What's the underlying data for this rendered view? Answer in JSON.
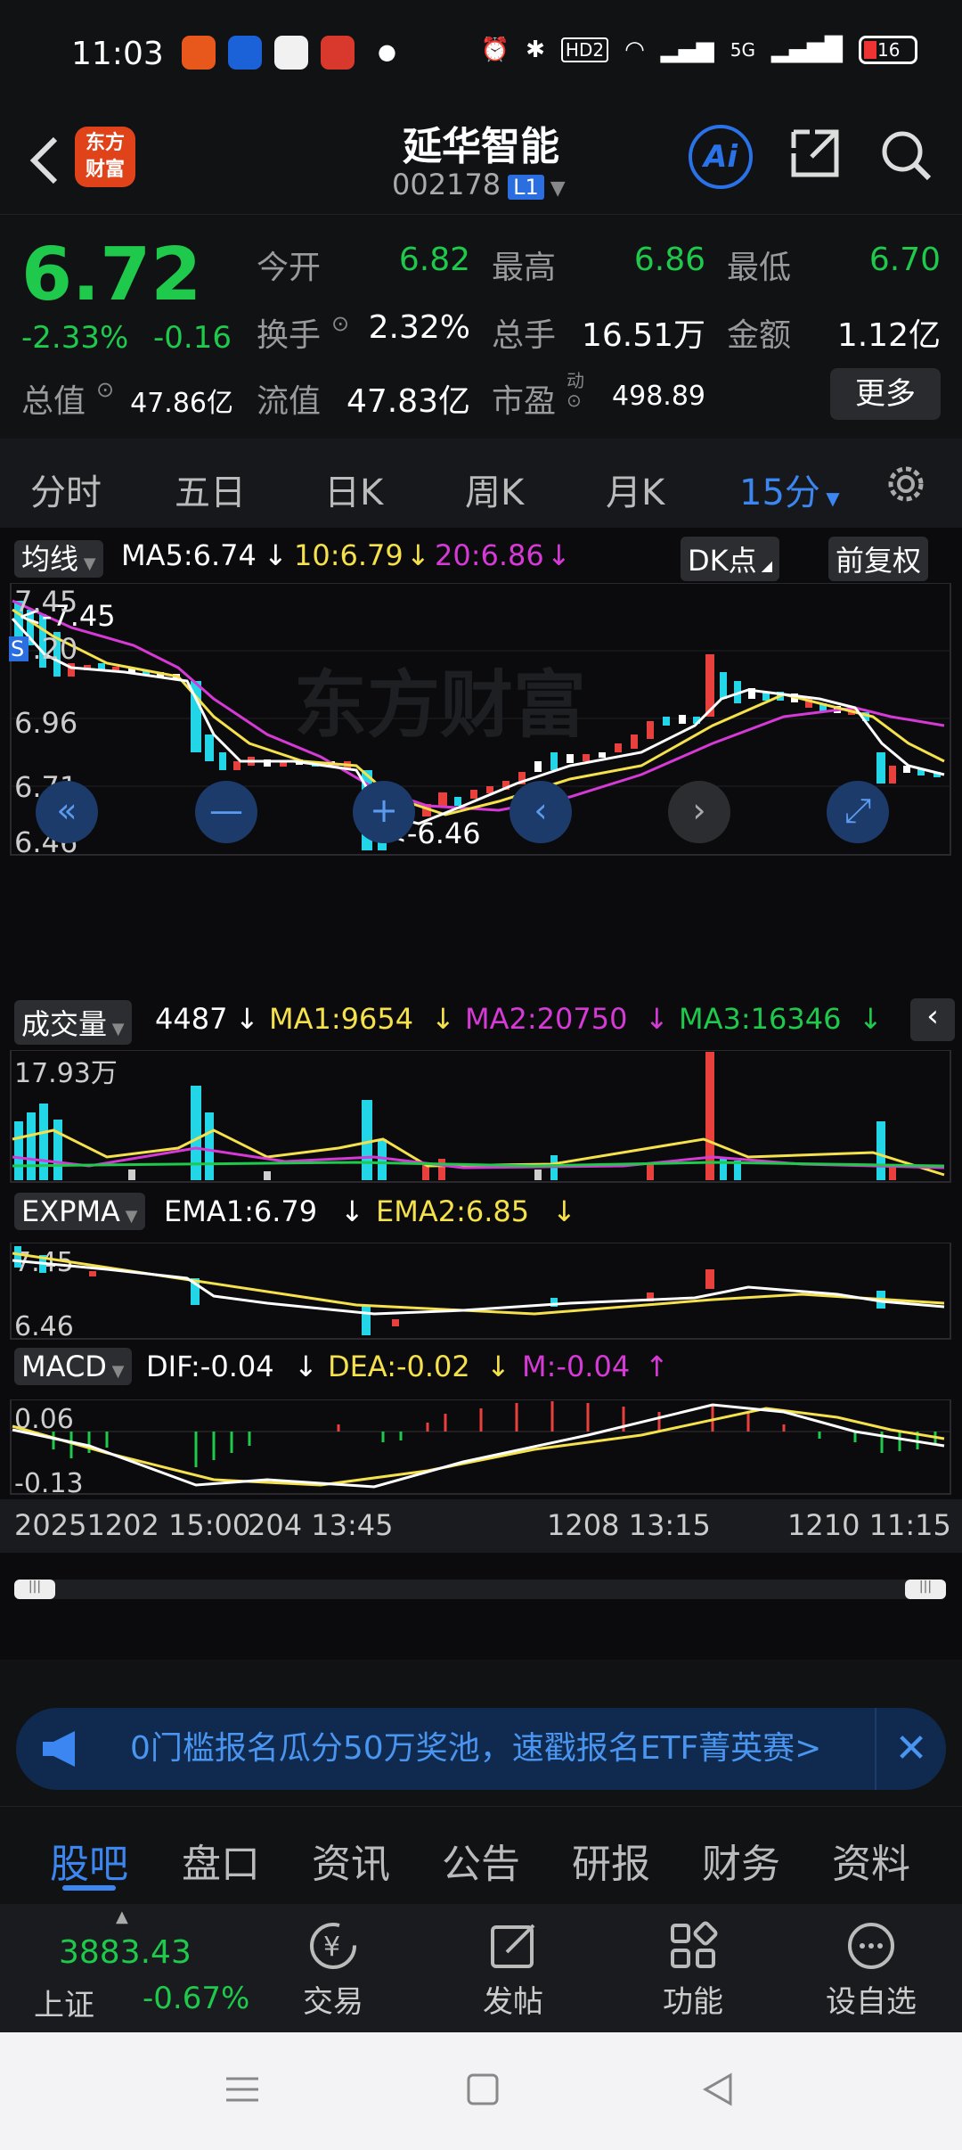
{
  "status_bar": {
    "time": "11:03",
    "battery": "16",
    "network": "5G",
    "hd": "HD2"
  },
  "header": {
    "title": "延华智能",
    "code": "002178",
    "level_badge": "L1",
    "logo_line1": "东方",
    "logo_line2": "财富",
    "ai_label": "Ai"
  },
  "quote": {
    "price": "6.72",
    "change_pct": "-2.33%",
    "change_abs": "-0.16",
    "open_label": "今开",
    "open": "6.82",
    "high_label": "最高",
    "high": "6.86",
    "low_label": "最低",
    "low": "6.70",
    "turnover_label": "换手",
    "turnover": "2.32%",
    "volume_label": "总手",
    "volume": "16.51万",
    "amount_label": "金额",
    "amount": "1.12亿",
    "total_mv_label": "总值",
    "total_mv": "47.86亿",
    "float_mv_label": "流值",
    "float_mv": "47.83亿",
    "pe_label": "市盈",
    "pe_sup": "动",
    "pe": "498.89",
    "more_label": "更多"
  },
  "periods": [
    "分时",
    "五日",
    "日K",
    "周K",
    "月K",
    "15分"
  ],
  "ma_legend": {
    "label": "均线",
    "ma5": "MA5:6.74",
    "ma10": "10:6.79",
    "ma20": "20:6.86",
    "dk_label": "DK点",
    "adjust_label": "前复权"
  },
  "main_axis": {
    "y1": "7.45",
    "y2": "7.20",
    "y3": "6.96",
    "y4": "6.71",
    "y5": "6.46",
    "max_marker": "<-7.45",
    "min_marker": "<-6.46",
    "watermark": "东方财富",
    "s_marker": "S"
  },
  "volume_legend": {
    "label": "成交量",
    "vol": "4487",
    "ma1": "MA1:9654",
    "ma2": "MA2:20750",
    "ma3": "MA3:16346",
    "axis_max": "17.93万"
  },
  "expma_legend": {
    "label": "EXPMA",
    "ema1": "EMA1:6.79",
    "ema2": "EMA2:6.85",
    "axis_top": "7.45",
    "axis_bottom": "6.46"
  },
  "macd_legend": {
    "label": "MACD",
    "dif": "DIF:-0.04",
    "dea": "DEA:-0.02",
    "m": "M:-0.04",
    "axis_top": "0.06",
    "axis_bottom": "-0.13"
  },
  "time_axis": {
    "t1": "20251202 15:00",
    "t2": "204 13:45",
    "t3": "1208 13:15",
    "t4": "1210 11:15"
  },
  "ad": {
    "text": "0门槛报名瓜分50万奖池，速戳报名ETF菁英赛>"
  },
  "bottom_tabs": [
    "股吧",
    "盘口",
    "资讯",
    "公告",
    "研报",
    "财务",
    "资料"
  ],
  "bottom_bar": {
    "index_value": "3883.43",
    "index_name": "上证",
    "index_change": "-0.67%",
    "trade": "交易",
    "post": "发帖",
    "functions": "功能",
    "watchlist": "设自选"
  },
  "colors": {
    "up": "#e8403c",
    "down": "#1ec94c",
    "cyan": "#22d6e8",
    "accent": "#3b86f0",
    "ma5": "#ffffff",
    "ma10": "#f5e14b",
    "ma20": "#d63ad6"
  }
}
